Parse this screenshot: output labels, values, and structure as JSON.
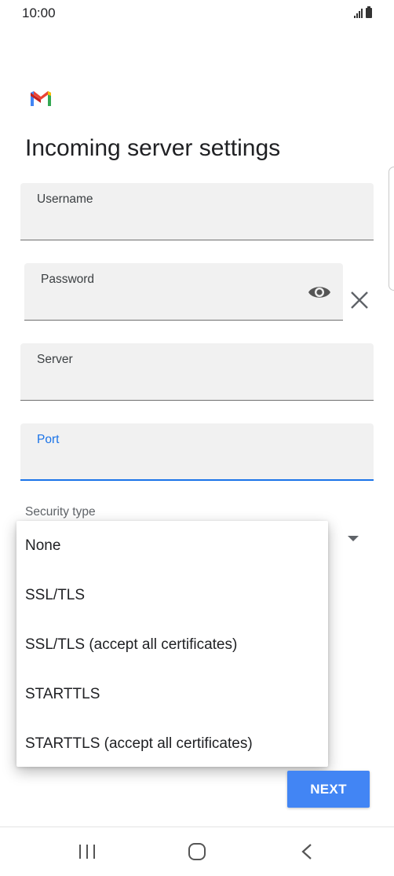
{
  "status_bar": {
    "time": "10:00",
    "icons": [
      "signal-icon",
      "battery-icon"
    ]
  },
  "app": {
    "logo": "gmail-logo",
    "logo_colors": [
      "#4285f4",
      "#ea4335",
      "#fbbc04",
      "#34a853",
      "#c5221f"
    ]
  },
  "page": {
    "title": "Incoming server settings"
  },
  "form": {
    "username": {
      "label": "Username",
      "value": ""
    },
    "password": {
      "label": "Password",
      "value": "",
      "icon": "eye-icon"
    },
    "server": {
      "label": "Server",
      "value": ""
    },
    "port": {
      "label": "Port",
      "value": "",
      "focused": true
    },
    "security_type": {
      "label": "Security type"
    }
  },
  "dropdown": {
    "options": [
      "None",
      "SSL/TLS",
      "SSL/TLS (accept all certificates)",
      "STARTTLS",
      "STARTTLS (accept all certificates)"
    ]
  },
  "actions": {
    "next_label": "NEXT"
  },
  "nav_bar": {
    "icons": [
      "recents-icon",
      "home-icon",
      "back-icon"
    ]
  },
  "colors": {
    "accent": "#1a73e8",
    "button": "#4285f4",
    "field_bg": "#f1f1f1"
  }
}
